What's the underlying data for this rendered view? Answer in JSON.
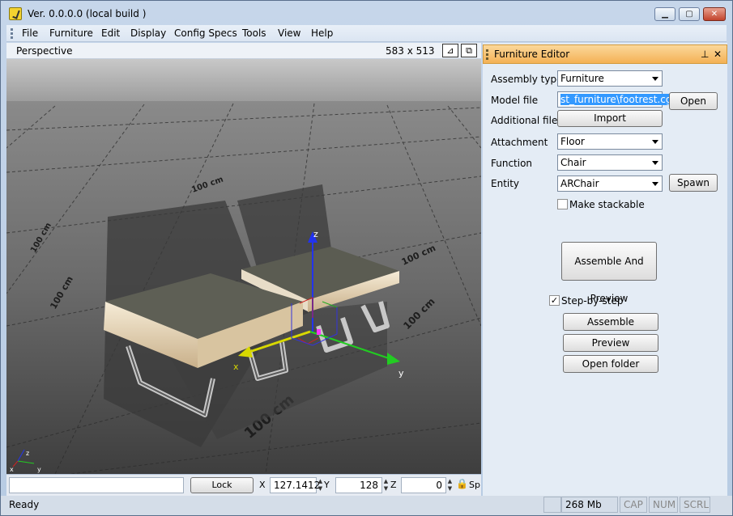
{
  "window": {
    "title": "Ver. 0.0.0.0 (local build )",
    "minimize_glyph": "▁",
    "maximize_glyph": "▢",
    "close_glyph": "✕"
  },
  "menu": [
    "File",
    "Furniture",
    "Edit",
    "Display",
    "Config Specs",
    "Tools",
    "View",
    "Help"
  ],
  "viewport": {
    "title": "Perspective",
    "size": "583 x 513",
    "maximize_glyph": "⊿",
    "restore_glyph": "⧉",
    "grid_labels": [
      "100 cm",
      "100 cm",
      "100 cm",
      "100 cm",
      "100 cm",
      "100 cm"
    ],
    "axis_labels": {
      "x": "x",
      "y": "y",
      "z": "z"
    },
    "corner_axes": {
      "x": "x",
      "y": "y",
      "z": "z"
    }
  },
  "toolbar": {
    "lock_selection": "Lock Selection",
    "x_label": "X",
    "x_value": "127.1412",
    "y_label": "Y",
    "y_value": "128",
    "z_label": "Z",
    "z_value": "0",
    "speed_label": "Sp",
    "lock_glyph": "🔒"
  },
  "status": {
    "text": "Ready",
    "memory": "268 Mb",
    "cap": "CAP",
    "num": "NUM",
    "scrl": "SCRL"
  },
  "panel": {
    "title": "Furniture Editor",
    "pin_glyph": "📌",
    "close_glyph": "✕",
    "assembly_type_label": "Assembly type",
    "assembly_type_value": "Furniture",
    "model_file_label": "Model file",
    "model_file_value": "st_furniture\\footrest.cgf",
    "open_button": "Open",
    "additional_files_label": "Additional files",
    "import_button": "Import",
    "attachment_label": "Attachment",
    "attachment_value": "Floor",
    "function_label": "Function",
    "function_value": "Chair",
    "entity_label": "Entity",
    "entity_value": "ARChair",
    "spawn_button": "Spawn",
    "make_stackable_label": "Make stackable",
    "make_stackable_checked": false,
    "assemble_preview_button": "Assemble And Preview",
    "step_by_step_label": "Step-by-step",
    "step_by_step_checked": true,
    "assemble_button": "Assemble",
    "preview_button": "Preview",
    "open_folder_button": "Open folder"
  }
}
